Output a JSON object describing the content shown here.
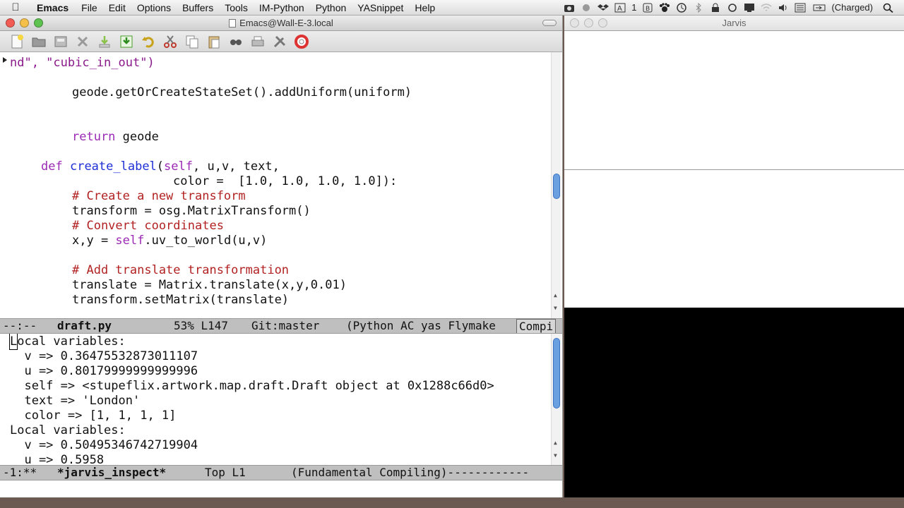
{
  "menubar": {
    "app": "Emacs",
    "items": [
      "File",
      "Edit",
      "Options",
      "Buffers",
      "Tools",
      "IM-Python",
      "Python",
      "YASnippet",
      "Help"
    ],
    "status": {
      "notifications_count": "1",
      "battery": "(Charged)"
    }
  },
  "emacs": {
    "title": "Emacs@Wall-E-3.local",
    "code_lines": [
      {
        "parts": [
          {
            "t": "nd\", \"cubic_in_out\")",
            "c": "str"
          }
        ]
      },
      {
        "parts": [
          {
            "t": "geode.getOrCreateStateSet().addUniform(uniform)",
            "c": "pl"
          }
        ]
      },
      {
        "parts": [
          {
            "t": "return",
            "c": "kw"
          },
          {
            "t": " geode",
            "c": "pl"
          }
        ]
      },
      {
        "parts": [
          {
            "t": "def",
            "c": "kw"
          },
          {
            "t": " ",
            "c": "pl"
          },
          {
            "t": "create_label",
            "c": "fn"
          },
          {
            "t": "(",
            "c": "pl"
          },
          {
            "t": "self",
            "c": "kw"
          },
          {
            "t": ", u,v, text,",
            "c": "pl"
          }
        ]
      },
      {
        "parts": [
          {
            "t": "color =  [1.0, 1.0, 1.0, 1.0]):",
            "c": "pl"
          }
        ]
      },
      {
        "parts": [
          {
            "t": "# Create a new transform",
            "c": "cmt"
          }
        ]
      },
      {
        "parts": [
          {
            "t": "transform = osg.MatrixTransform()",
            "c": "pl"
          }
        ]
      },
      {
        "parts": [
          {
            "t": "# Convert coordinates",
            "c": "cmt"
          }
        ]
      },
      {
        "parts": [
          {
            "t": "x,y = ",
            "c": "pl"
          },
          {
            "t": "self",
            "c": "kw"
          },
          {
            "t": ".uv_to_world(u,v)",
            "c": "pl"
          }
        ]
      },
      {
        "parts": [
          {
            "t": "# Add translate transformation",
            "c": "cmt"
          }
        ]
      },
      {
        "parts": [
          {
            "t": "translate = Matrix.translate(x,y,0.01)",
            "c": "pl"
          }
        ]
      },
      {
        "parts": [
          {
            "t": "transform.setMatrix(translate)",
            "c": "pl"
          }
        ]
      }
    ],
    "modeline_top": {
      "state": "--:--",
      "buffer": "draft.py",
      "position": "53% L147",
      "vc": "Git:master",
      "modes": "(Python AC yas Flymake",
      "extra": "Compi"
    },
    "inspect_lines": [
      "Local variables:",
      "  v => 0.36475532873011107",
      "  u => 0.80179999999999996",
      "  self => <stupeflix.artwork.map.draft.Draft object at 0x1288c66d0>",
      "  text => 'London'",
      "  color => [1, 1, 1, 1]",
      "Local variables:",
      "  v => 0.50495346742719904",
      "  u => 0.5958"
    ],
    "modeline_bottom": {
      "state": "-1:**",
      "buffer": "*jarvis_inspect*",
      "position": "Top L1",
      "modes": "(Fundamental Compiling)------------"
    }
  },
  "jarvis": {
    "title": "Jarvis"
  },
  "colors": {
    "keyword": "#9b2ab5",
    "function": "#1f2fd6",
    "comment": "#b22222",
    "scroll_thumb": "#6aa0e0"
  },
  "icons": {
    "menubar_status": [
      "camera-icon",
      "cloud-icon",
      "dropbox-icon",
      "adobe-icon",
      "bluetooth-b-icon",
      "paw-icon",
      "time-machine-icon",
      "bluetooth-icon",
      "lock-icon",
      "sync-icon",
      "display-icon",
      "wifi-icon",
      "volume-icon",
      "flag-icon",
      "battery-icon",
      "spotlight-icon"
    ],
    "toolbar": [
      "new-file-icon",
      "open-folder-icon",
      "dired-icon",
      "close-buffer-icon",
      "save-icon",
      "save-as-icon",
      "undo-icon",
      "cut-icon",
      "copy-icon",
      "paste-icon",
      "search-icon",
      "print-icon",
      "preferences-icon",
      "help-icon"
    ]
  }
}
